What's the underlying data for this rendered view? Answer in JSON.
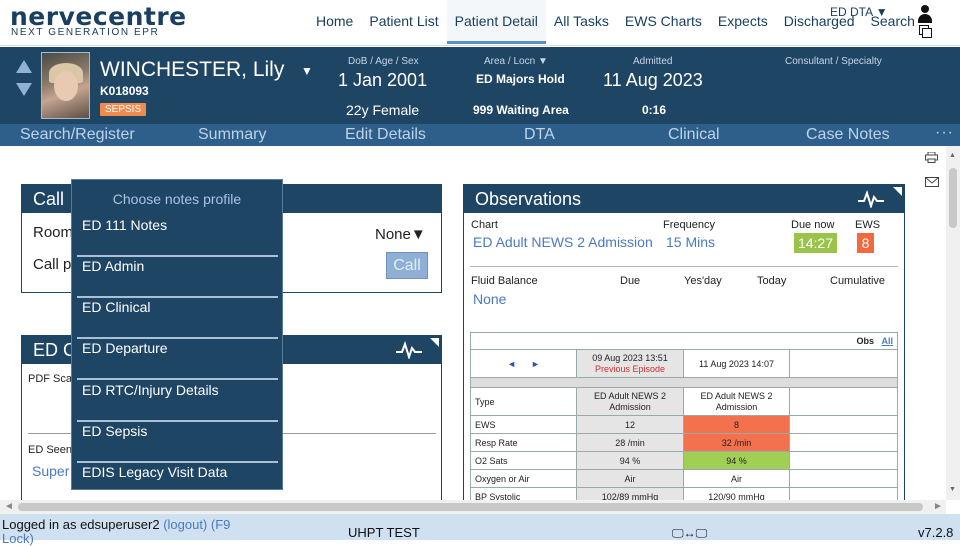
{
  "brand": {
    "name": "nervecentre",
    "tagline": "NEXT GENERATION EPR"
  },
  "nav": {
    "items": [
      "Home",
      "Patient List",
      "Patient Detail",
      "All Tasks",
      "EWS Charts",
      "Expects",
      "Discharged",
      "Search"
    ],
    "active": "Patient Detail",
    "ed_dta": "ED DTA"
  },
  "patient": {
    "name": "WINCHESTER, Lily",
    "number": "K018093",
    "alert": "SEPSIS",
    "dob_label": "DoB / Age / Sex",
    "dob": "1 Jan 2001",
    "age_sex": "22y Female",
    "area_label": "Area / Locn",
    "area": "ED Majors Hold",
    "locn": "999 Waiting Area",
    "admitted_label": "Admitted",
    "admitted": "11 Aug 2023",
    "admitted_time": "0:16",
    "consultant_label": "Consultant / Specialty"
  },
  "subnav": [
    "Search/Register",
    "Summary",
    "Edit Details",
    "DTA",
    "Clinical",
    "Case Notes"
  ],
  "call_panel": {
    "title_partial": "Call",
    "room_label": "Room",
    "call_label": "Call p",
    "room_value": "None",
    "call_button": "Call"
  },
  "ed_panel": {
    "title_partial": "ED C",
    "pdf_label": "PDF Sca",
    "seen_label": "ED Seen",
    "seen_value": "Super"
  },
  "dropdown": {
    "title": "Choose notes profile",
    "items": [
      "ED 111 Notes",
      "ED Admin",
      "ED Clinical",
      "ED Departure",
      "ED RTC/Injury Details",
      "ED Sepsis",
      "EDIS Legacy Visit Data"
    ]
  },
  "observations": {
    "title": "Observations",
    "chart_label": "Chart",
    "chart_value": "ED Adult NEWS 2 Admission",
    "frequency_label": "Frequency",
    "frequency_value": "15 Mins",
    "due_label": "Due now",
    "due_value": "14:27",
    "ews_label": "EWS",
    "ews_value": "8",
    "fluid_label": "Fluid Balance",
    "fluid_value": "None",
    "due_col": "Due",
    "yesday_col": "Yes'day",
    "today_col": "Today",
    "cumulative_col": "Cumulative",
    "obs_label": "Obs",
    "all_link": "All",
    "col1_date": "09 Aug 2023 13:51",
    "col1_sub": "Previous Episode",
    "col2_date": "11 Aug 2023 14:07",
    "rows": [
      {
        "label": "Type",
        "c1": "ED Adult NEWS 2 Admission",
        "c2": "ED Adult NEWS 2 Admission"
      },
      {
        "label": "EWS",
        "c1": "12",
        "c2": "8"
      },
      {
        "label": "Resp Rate",
        "c1": "28 /min",
        "c2": "32 /min"
      },
      {
        "label": "O2 Sats",
        "c1": "94 %",
        "c2": "94 %"
      },
      {
        "label": "Oxygen or Air",
        "c1": "Air",
        "c2": "Air"
      },
      {
        "label": "BP Systolic",
        "c1": "102/89 mmHg",
        "c2": "120/90 mmHg"
      }
    ]
  },
  "footer": {
    "logged_in": "Logged in as edsuperuser2",
    "logout": "(logout)",
    "lock": "(F9 Lock)",
    "env": "UHPT TEST",
    "version": "v7.2.8"
  },
  "colors": {
    "banner": "#1f4565",
    "subnav": "#2e5f8a",
    "link": "#4a7ac2",
    "red": "#f4714d",
    "green": "#a1cf55"
  }
}
